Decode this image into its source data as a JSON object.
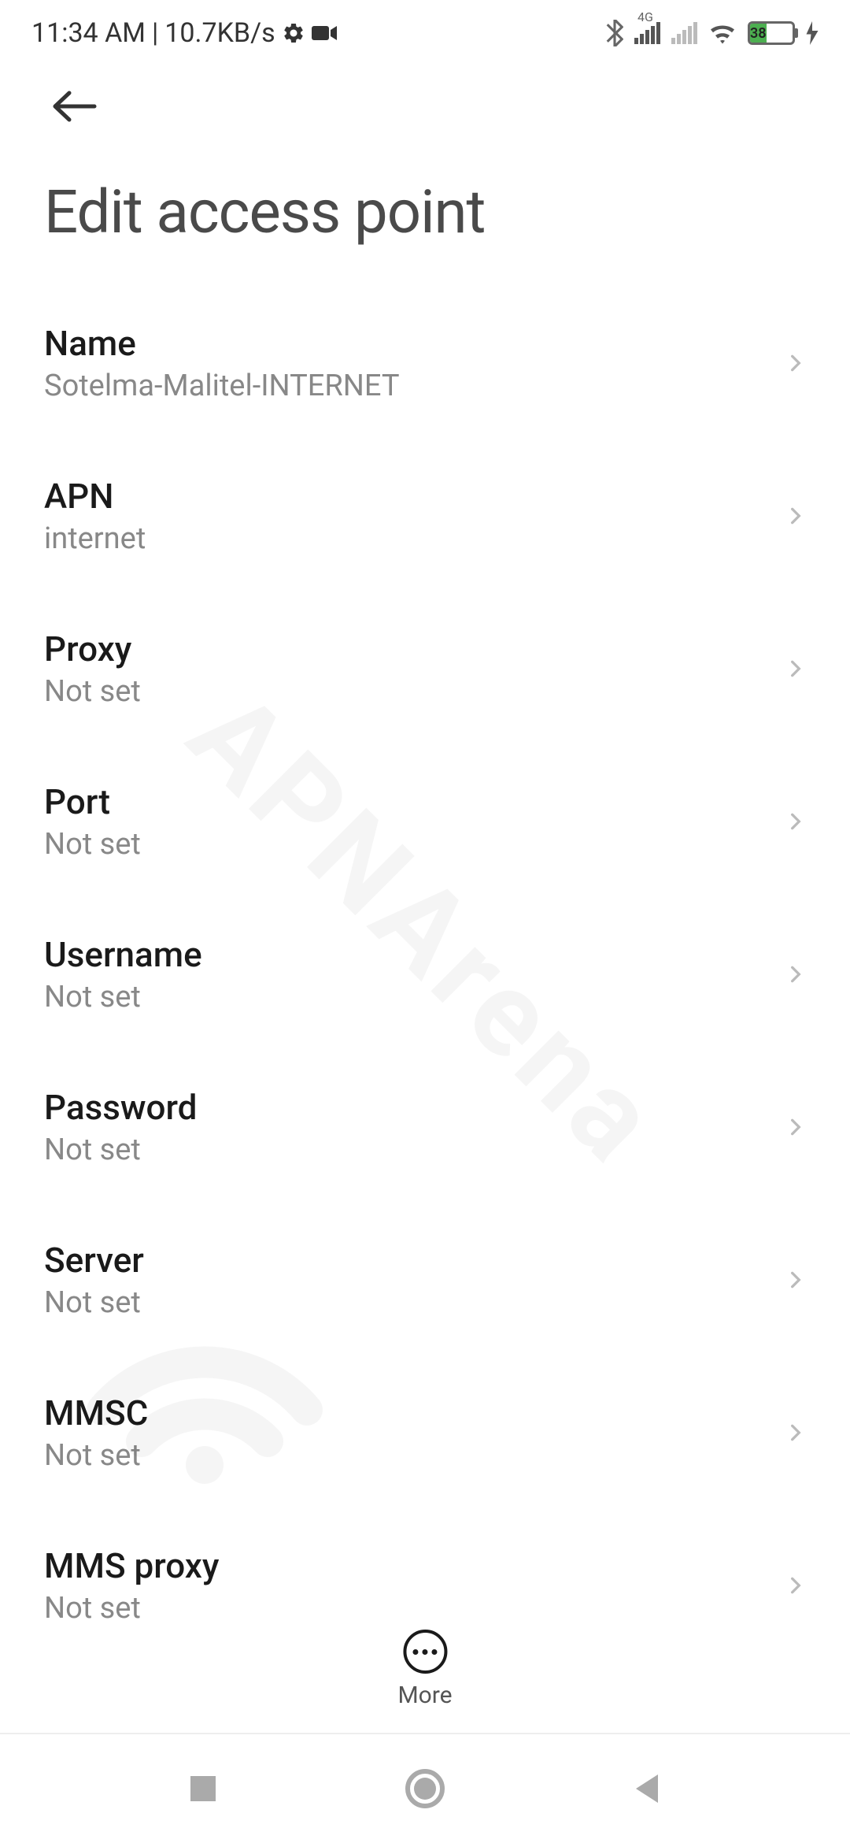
{
  "status": {
    "time": "11:34 AM",
    "dataRate": "10.7KB/s",
    "networkType": "4G",
    "batteryPercent": "38"
  },
  "page": {
    "title": "Edit access point"
  },
  "settings": [
    {
      "label": "Name",
      "value": "Sotelma-Malitel-INTERNET"
    },
    {
      "label": "APN",
      "value": "internet"
    },
    {
      "label": "Proxy",
      "value": "Not set"
    },
    {
      "label": "Port",
      "value": "Not set"
    },
    {
      "label": "Username",
      "value": "Not set"
    },
    {
      "label": "Password",
      "value": "Not set"
    },
    {
      "label": "Server",
      "value": "Not set"
    },
    {
      "label": "MMSC",
      "value": "Not set"
    },
    {
      "label": "MMS proxy",
      "value": "Not set"
    }
  ],
  "more": {
    "label": "More"
  },
  "watermark": "APNArena"
}
